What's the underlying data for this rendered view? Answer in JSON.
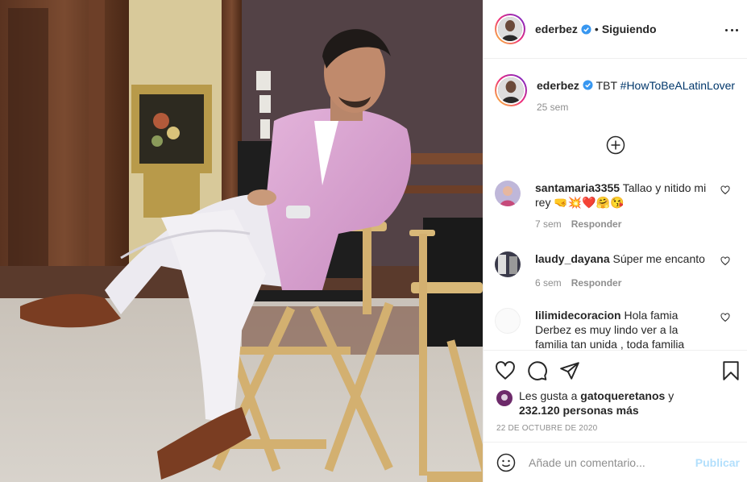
{
  "post": {
    "username": "ederbez",
    "follow_status": "Siguiendo",
    "dot": "•",
    "caption": "TBT",
    "hashtag": "#HowToBeALatinLover",
    "caption_time": "25 sem",
    "verified": true
  },
  "comments": [
    {
      "username": "santamaria3355",
      "text": "Tallao y nitido mi rey 🤜💥❤️🤗😘",
      "time": "7 sem",
      "reply_label": "Responder"
    },
    {
      "username": "laudy_dayana",
      "text": "Súper me encanto",
      "time": "6 sem",
      "reply_label": "Responder"
    },
    {
      "username": "lilimidecoracion",
      "text": "Hola famia Derbez es muy lindo ver a la familia tan unida , toda familia"
    }
  ],
  "likes": {
    "prefix": "Les gusta a",
    "user": "gatoqueretanos",
    "joiner": "y",
    "count_text": "232.120 personas más"
  },
  "date": "22 DE OCTUBRE DE 2020",
  "add_comment": {
    "placeholder": "Añade un comentario...",
    "post_label": "Publicar"
  },
  "colors": {
    "link": "#00376b",
    "verified": "#3897f0",
    "post_button_disabled": "#b2dffc",
    "meta_text": "#8e8e8e"
  },
  "icons": [
    "more-options-icon",
    "verified-badge-icon",
    "load-more-comments-icon",
    "like-heart-icon",
    "comment-icon",
    "share-icon",
    "save-bookmark-icon",
    "emoji-icon"
  ]
}
